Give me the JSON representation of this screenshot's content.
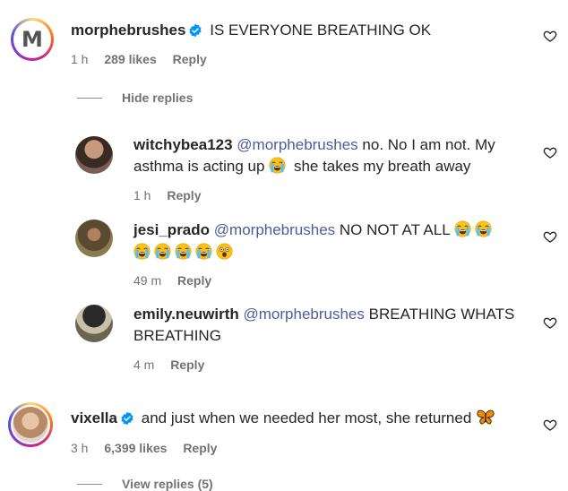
{
  "comments": [
    {
      "username": "morphebrushes",
      "verified": true,
      "text": "IS EVERYONE BREATHING OK",
      "time": "1 h",
      "likes": "289 likes",
      "reply": "Reply",
      "avatar_letter": "M"
    },
    {
      "username": "vixella",
      "verified": true,
      "text": "and just when we needed her most, she returned",
      "time": "3 h",
      "likes": "6,399 likes",
      "reply": "Reply",
      "emoji": "butterfly-emoji"
    }
  ],
  "hide_replies": "Hide replies",
  "view_replies": "View replies (5)",
  "replies": [
    {
      "username": "witchybea123",
      "mention": "@morphebrushes",
      "text_line1": "no. No I am not. My",
      "text_line2a": "asthma is acting up",
      "text_line2b": "she takes my breath away",
      "time": "1 h",
      "reply": "Reply"
    },
    {
      "username": "jesi_prado",
      "mention": "@morphebrushes",
      "text_line1": "NO NOT AT ALL",
      "time": "49 m",
      "reply": "Reply"
    },
    {
      "username": "emily.neuwirth",
      "mention": "@morphebrushes",
      "text_line1": "BREATHING WHATS",
      "text_line2": "BREATHING",
      "time": "4 m",
      "reply": "Reply"
    }
  ],
  "icons": {
    "like": "heart-icon",
    "verified": "verified-badge-icon",
    "crying": "loudly-crying-face-emoji",
    "shocked": "face-with-open-mouth-emoji"
  },
  "colors": {
    "mention": "#4a5d9e",
    "verified": "#0095f6",
    "meta": "#737373"
  }
}
